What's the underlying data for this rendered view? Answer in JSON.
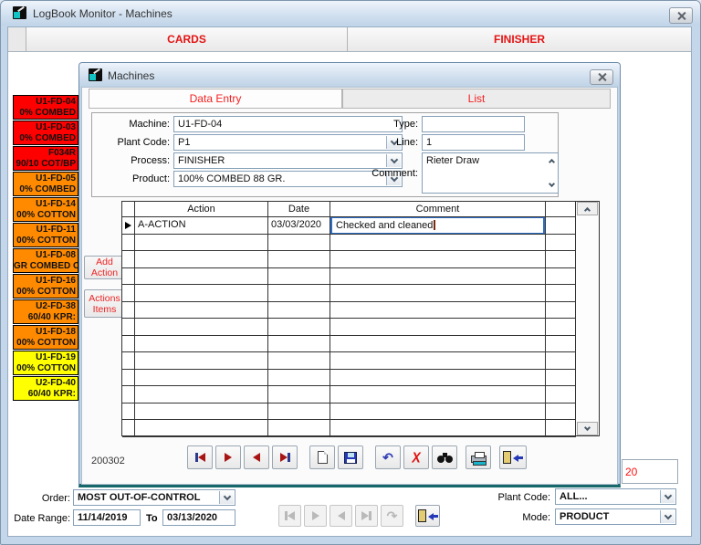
{
  "window": {
    "title": "LogBook Monitor - Machines"
  },
  "main_tabs": {
    "cards": "CARDS",
    "finisher": "FINISHER"
  },
  "machine_list": [
    {
      "name": "U1-FD-04",
      "product": "0% COMBED",
      "color": "#ff0000"
    },
    {
      "name": "U1-FD-03",
      "product": "0% COMBED",
      "color": "#ff0000"
    },
    {
      "name": "F034R",
      "product": "90/10 COT/BP",
      "color": "#ff0000"
    },
    {
      "name": "U1-FD-05",
      "product": "0% COMBED",
      "color": "#ff8a00"
    },
    {
      "name": "U1-FD-14",
      "product": "00% COTTON",
      "color": "#ff8a00"
    },
    {
      "name": "U1-FD-11",
      "product": "00% COTTON",
      "color": "#ff8a00"
    },
    {
      "name": "U1-FD-08",
      "product": "GR COMBED C",
      "color": "#ff8a00"
    },
    {
      "name": "U1-FD-16",
      "product": "00% COTTON",
      "color": "#ff8a00"
    },
    {
      "name": "U2-FD-38",
      "product": "60/40 KPR:",
      "color": "#ff8a00"
    },
    {
      "name": "U1-FD-18",
      "product": "00% COTTON",
      "color": "#ff8a00"
    },
    {
      "name": "U1-FD-19",
      "product": "00% COTTON",
      "color": "#ffff00"
    },
    {
      "name": "U2-FD-40",
      "product": "60/40 KPR:",
      "color": "#ffff00"
    }
  ],
  "dialog": {
    "title": "Machines",
    "tabs": {
      "data_entry": "Data Entry",
      "list": "List"
    },
    "form": {
      "machine_label": "Machine:",
      "machine_value": "U1-FD-04",
      "plant_code_label": "Plant Code:",
      "plant_code_value": "P1",
      "process_label": "Process:",
      "process_value": "FINISHER",
      "product_label": "Product:",
      "product_value": "100% COMBED  88 GR.",
      "type_label": "Type:",
      "type_value": "",
      "line_label": "Line:",
      "line_value": "1",
      "comment_label": "Comment:",
      "comment_value": "Rieter Draw"
    },
    "grid": {
      "columns": [
        "Action",
        "Date",
        "Comment"
      ],
      "rows": [
        {
          "action": "A-ACTION",
          "date": "03/03/2020",
          "comment": "Checked and cleaned"
        }
      ],
      "empty_rows": 12
    },
    "side_buttons": {
      "add_1": "Add",
      "add_2": "Action",
      "items_1": "Actions",
      "items_2": "Items"
    },
    "record_id": "200302",
    "toolbar_icons": [
      "move-first",
      "move-next",
      "move-previous",
      "move-last",
      "new-record",
      "save",
      "undo",
      "delete",
      "find",
      "print",
      "exit"
    ]
  },
  "background_partial": {
    "value": "20"
  },
  "bottom_bar": {
    "order_label": "Order:",
    "order_value": "MOST OUT-OF-CONTROL",
    "date_range_label": "Date Range:",
    "date_from": "11/14/2019",
    "to_label": "To",
    "date_to": "03/13/2020",
    "nav_icons": [
      "move-first",
      "move-next",
      "move-previous",
      "move-last",
      "redo",
      "exit"
    ],
    "plant_code_label": "Plant Code:",
    "plant_code_value": "ALL...",
    "mode_label": "Mode:",
    "mode_value": "PRODUCT"
  },
  "colors": {
    "tab_text_red": "#e41414",
    "alert_red": "#ff0000",
    "alert_orange": "#ff8a00",
    "alert_yellow": "#ffff00",
    "dialog_bottom_teal": "#17686a",
    "focus_border_blue": "#2e6ec6"
  }
}
